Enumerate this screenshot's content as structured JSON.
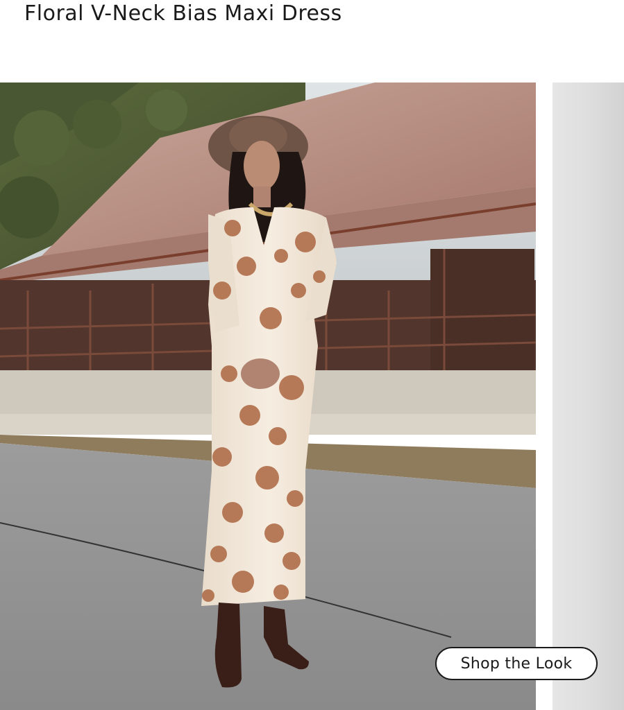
{
  "product": {
    "title": "Floral V-Neck Bias Maxi Dress"
  },
  "hero": {
    "cta_label": "Shop the Look"
  },
  "colors": {
    "accent_text": "#1a1a1a",
    "dress_print": "#b06e4a",
    "dress_base": "#f1e6d8",
    "roof": "#b58a7d"
  }
}
